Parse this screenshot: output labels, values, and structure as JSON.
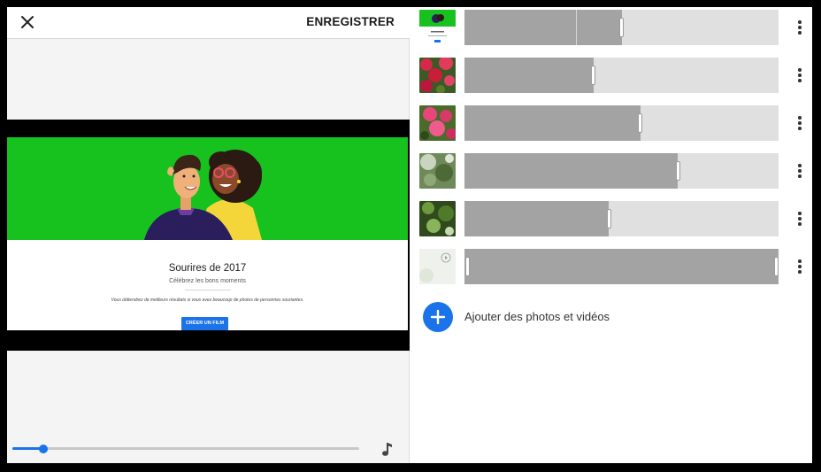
{
  "toolbar": {
    "close_icon": "close-icon",
    "save_label": "ENREGISTRER"
  },
  "preview": {
    "title": "Sourires de 2017",
    "subtitle": "Célébrez les bons moments",
    "description": "Vous obtiendrez de meilleurs résultats si vous avez beaucoup de photos de personnes souriantes.",
    "button_label": "CRÉER UN FILM",
    "hero_color": "#17c21e",
    "button_color": "#1a73e8"
  },
  "player": {
    "progress": 0.09,
    "music_icon": "music-note-icon"
  },
  "clips": [
    {
      "thumbnail": "title-card-thumbnail",
      "trim_end": 0.5,
      "has_split": true
    },
    {
      "thumbnail": "red-flowers-thumbnail",
      "trim_end": 0.41
    },
    {
      "thumbnail": "pink-flowers-thumbnail",
      "trim_end": 0.56
    },
    {
      "thumbnail": "foliage-light-thumbnail",
      "trim_end": 0.68
    },
    {
      "thumbnail": "green-foliage-thumbnail",
      "trim_end": 0.46
    },
    {
      "thumbnail": "video-thumbnail",
      "trim_start": 0.0,
      "trim_end": 1.0,
      "is_video": true
    }
  ],
  "add_media": {
    "label": "Ajouter des photos et vidéos",
    "icon": "plus-icon"
  },
  "accent_color": "#1a73e8"
}
